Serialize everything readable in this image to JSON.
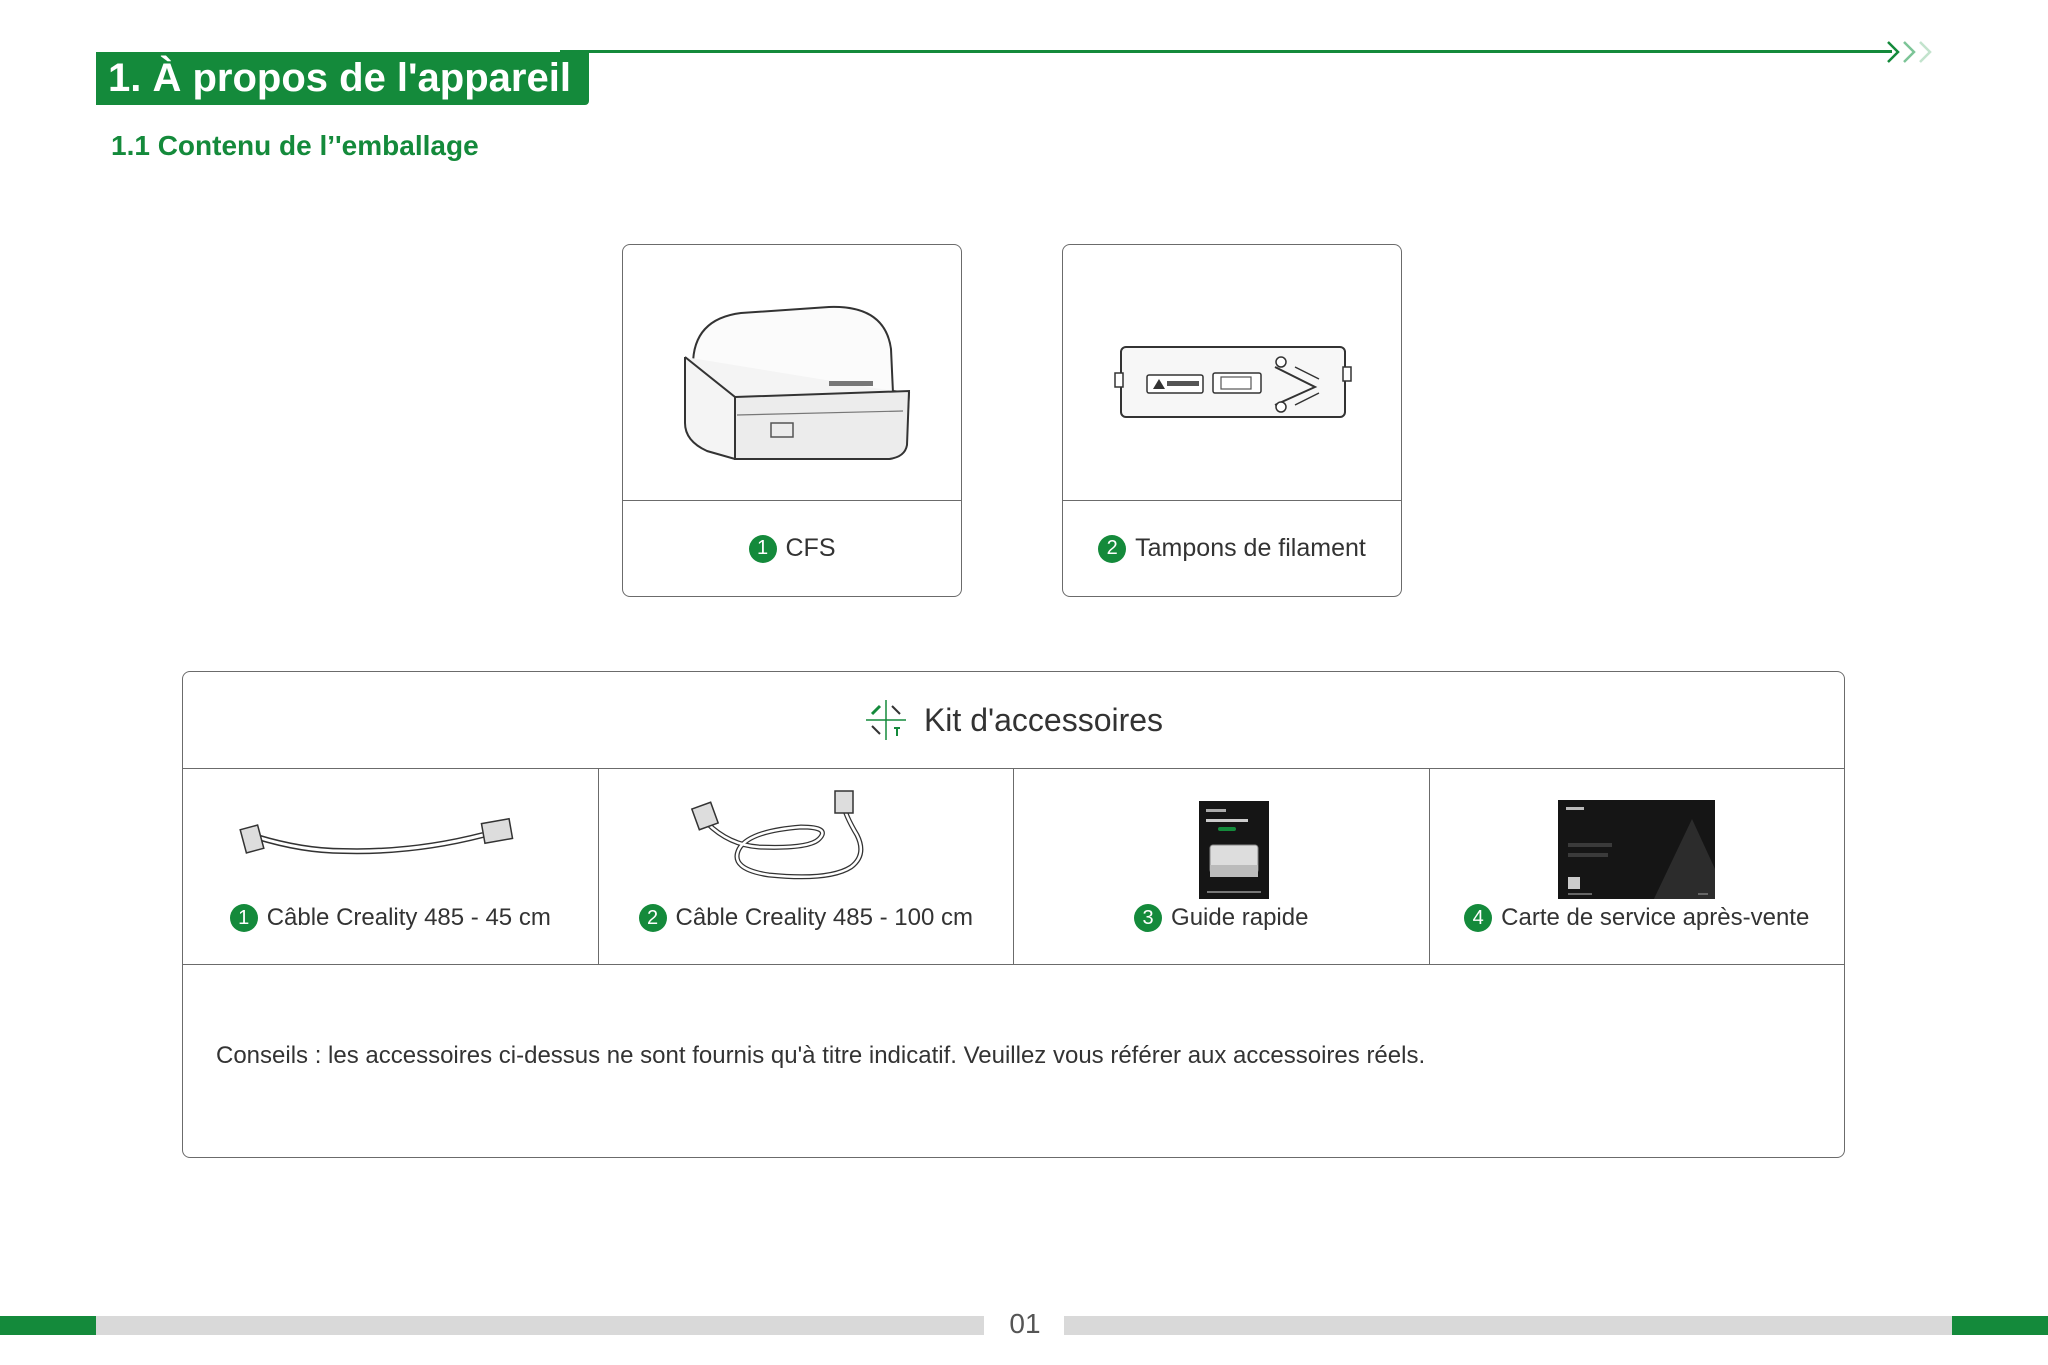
{
  "header": {
    "section_title": "1. À propos de l'appareil",
    "subsection_title": "1.1 Contenu de l’'emballage",
    "accent_color": "#148a3b"
  },
  "package_items": [
    {
      "number": "1",
      "label": "CFS",
      "icon": "cfs-unit-illustration"
    },
    {
      "number": "2",
      "label": "Tampons de filament",
      "icon": "filament-buffer-illustration"
    }
  ],
  "kit": {
    "title": "Kit d'accessoires",
    "icon": "tools-icon",
    "items": [
      {
        "number": "1",
        "label": "Câble Creality 485 - 45 cm",
        "icon": "short-cable-illustration"
      },
      {
        "number": "2",
        "label": "Câble Creality 485 - 100 cm",
        "icon": "long-cable-illustration"
      },
      {
        "number": "3",
        "label": "Guide rapide",
        "icon": "quick-guide-booklet"
      },
      {
        "number": "4",
        "label": "Carte de service après-vente",
        "icon": "service-card"
      }
    ],
    "note": "Conseils : les accessoires ci-dessus ne sont fournis qu'à titre indicatif. Veuillez vous référer aux accessoires réels."
  },
  "footer": {
    "page_number": "01"
  }
}
